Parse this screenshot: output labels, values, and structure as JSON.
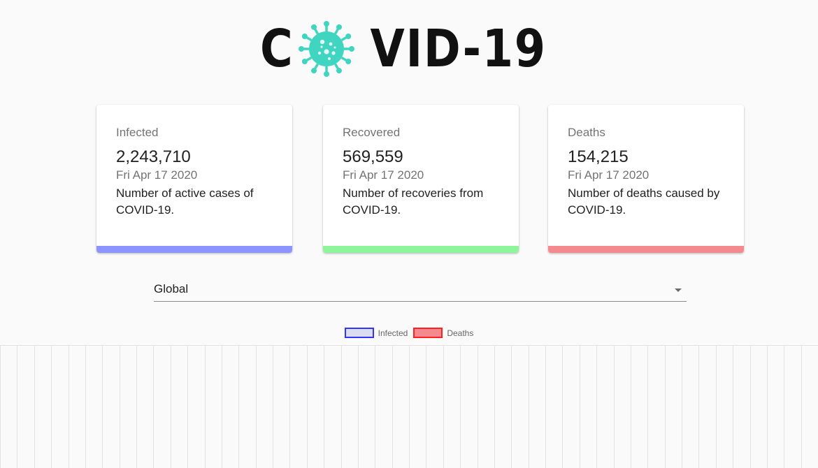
{
  "logo": {
    "text_before": "C",
    "text_after": "VID-19",
    "virus_icon": "coronavirus-icon",
    "virus_color": "#3fd5c0"
  },
  "cards": [
    {
      "title": "Infected",
      "count": "2,243,710",
      "date": "Fri Apr 17 2020",
      "description": "Number of active cases of COVID-19.",
      "color": "#8c94ff"
    },
    {
      "title": "Recovered",
      "count": "569,559",
      "date": "Fri Apr 17 2020",
      "description": "Number of recoveries from COVID-19.",
      "color": "#8ff59a"
    },
    {
      "title": "Deaths",
      "count": "154,215",
      "date": "Fri Apr 17 2020",
      "description": "Number of deaths caused by COVID-19.",
      "color": "#f58a8e"
    }
  ],
  "country_select": {
    "value": "Global",
    "arrow_icon": "dropdown-arrow-icon"
  },
  "chart_data": {
    "type": "line",
    "title": "",
    "xlabel": "",
    "ylabel": "",
    "grid": true,
    "legend_position": "top-center",
    "series": [
      {
        "name": "Infected",
        "border_color": "#3333ff",
        "fill_color": "#dcdcf0"
      },
      {
        "name": "Deaths",
        "border_color": "#ff2020",
        "fill_color": "#f58a8e"
      }
    ],
    "vertical_gridlines": 48
  }
}
